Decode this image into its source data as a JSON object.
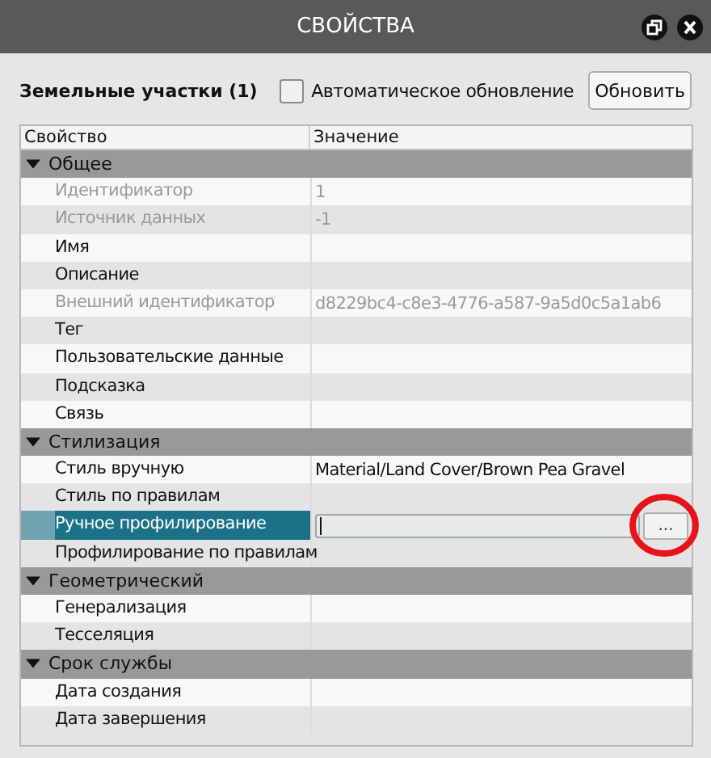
{
  "window": {
    "title": "СВОЙСТВА"
  },
  "header": {
    "title": "Земельные участки (1)",
    "auto_update": {
      "label": "Автоматическое обновление",
      "checked": false
    },
    "refresh_button": "Обновить"
  },
  "table": {
    "columns": [
      "Свойство",
      "Значение"
    ],
    "groups": [
      {
        "label": "Общее",
        "expanded": true,
        "rows": [
          {
            "kind": "text",
            "name": "Идентификатор",
            "value": "1",
            "disabled": true,
            "selected": false
          },
          {
            "kind": "text",
            "name": "Источник данных",
            "value": "-1",
            "disabled": true,
            "selected": false
          },
          {
            "kind": "text",
            "name": "Имя",
            "disabled": false,
            "selected": false
          },
          {
            "kind": "text",
            "name": "Описание",
            "disabled": false,
            "selected": false
          },
          {
            "kind": "text",
            "name": "Внешний идентификатор",
            "value": "d8229bc4-c8e3-4776-a587-9a5d0c5a1ab6",
            "disabled": true,
            "selected": false
          },
          {
            "kind": "text",
            "name": "Тег",
            "disabled": false,
            "selected": false
          },
          {
            "kind": "text",
            "name": "Пользовательские данные",
            "disabled": false,
            "selected": false
          },
          {
            "kind": "text",
            "name": "Подсказка",
            "disabled": false,
            "selected": false
          },
          {
            "kind": "text",
            "name": "Связь",
            "disabled": false,
            "selected": false
          }
        ]
      },
      {
        "label": "Стилизация",
        "expanded": true,
        "rows": [
          {
            "kind": "text",
            "name": "Стиль вручную",
            "value": "Material/Land Cover/Brown Pea Gravel",
            "disabled": false,
            "selected": false
          },
          {
            "kind": "text",
            "name": "Стиль по правилам",
            "disabled": false,
            "selected": false
          },
          {
            "kind": "editor",
            "name": "Ручное профилирование",
            "button": "...",
            "circled": true,
            "disabled": false,
            "selected": true
          },
          {
            "kind": "text",
            "name": "Профилирование по правилам",
            "disabled": false,
            "selected": false
          }
        ]
      },
      {
        "label": "Геометрический",
        "expanded": true,
        "rows": [
          {
            "kind": "text",
            "name": "Генерализация",
            "disabled": false,
            "selected": false
          },
          {
            "kind": "text",
            "name": "Тесселяция",
            "disabled": false,
            "selected": false
          }
        ]
      },
      {
        "label": "Срок службы",
        "expanded": true,
        "rows": [
          {
            "kind": "text",
            "name": "Дата создания",
            "disabled": false,
            "selected": false
          },
          {
            "kind": "text",
            "name": "Дата завершения",
            "disabled": false,
            "selected": false
          }
        ]
      }
    ]
  }
}
